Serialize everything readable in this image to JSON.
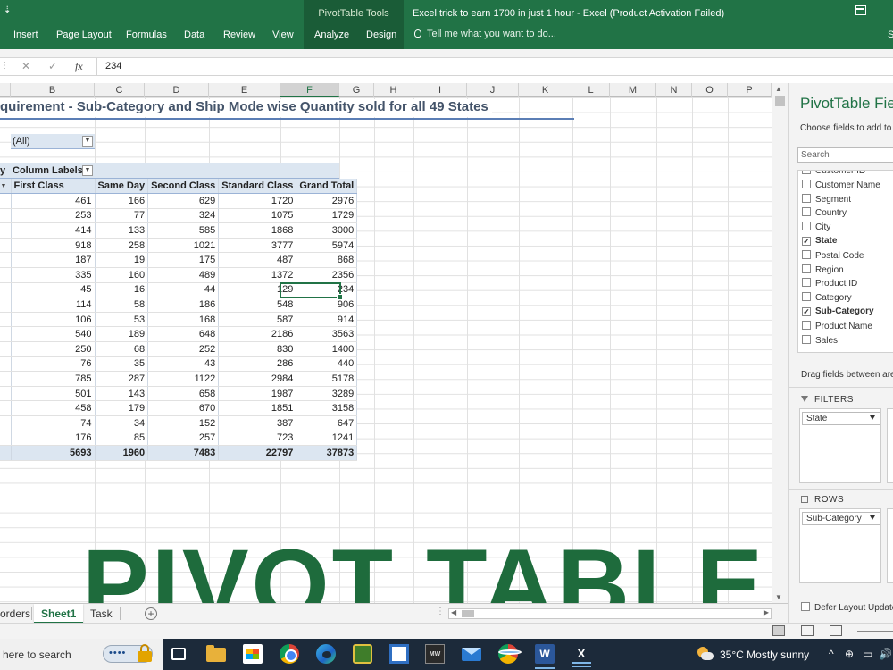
{
  "ribbon": {
    "contextual_group": "PivotTable Tools",
    "window_title": "Excel trick to earn 1700 in just 1 hour - Excel (Product Activation Failed)",
    "tabs": [
      "Insert",
      "Page Layout",
      "Formulas",
      "Data",
      "Review",
      "View",
      "Analyze",
      "Design"
    ],
    "tell_me": "Tell me what you want to do...",
    "user_initial": "S",
    "qa_arrow": "⇣",
    "restore_icon": "ribbon-display-icon"
  },
  "formula_bar": {
    "cancel_glyph": "✕",
    "enter_glyph": "✓",
    "fx": "fx",
    "value": "234"
  },
  "columns": [
    "B",
    "C",
    "D",
    "E",
    "F",
    "G",
    "H",
    "I",
    "J",
    "K",
    "L",
    "M",
    "N",
    "O",
    "P"
  ],
  "selected_column": "F",
  "sheet": {
    "title": "quirement - Sub-Category and Ship Mode wise Quantity sold for all 49 States",
    "filter_value": "(All)",
    "row_labels_fragment": "y",
    "column_labels": "Column Labels",
    "headers": [
      "First Class",
      "Same Day",
      "Second Class",
      "Standard Class",
      "Grand Total"
    ],
    "rows": [
      [
        461,
        166,
        629,
        1720,
        2976
      ],
      [
        253,
        77,
        324,
        1075,
        1729
      ],
      [
        414,
        133,
        585,
        1868,
        3000
      ],
      [
        918,
        258,
        1021,
        3777,
        5974
      ],
      [
        187,
        19,
        175,
        487,
        868
      ],
      [
        335,
        160,
        489,
        1372,
        2356
      ],
      [
        45,
        16,
        44,
        129,
        234
      ],
      [
        114,
        58,
        186,
        548,
        906
      ],
      [
        106,
        53,
        168,
        587,
        914
      ],
      [
        540,
        189,
        648,
        2186,
        3563
      ],
      [
        250,
        68,
        252,
        830,
        1400
      ],
      [
        76,
        35,
        43,
        286,
        440
      ],
      [
        785,
        287,
        1122,
        2984,
        5178
      ],
      [
        501,
        143,
        658,
        1987,
        3289
      ],
      [
        458,
        179,
        670,
        1851,
        3158
      ],
      [
        74,
        34,
        152,
        387,
        647
      ],
      [
        176,
        85,
        257,
        723,
        1241
      ]
    ],
    "totals": [
      "5693",
      "1960",
      "7483",
      "22797",
      "37873"
    ]
  },
  "overlay_text": "PIVOT TABLE",
  "sheet_tabs": [
    {
      "label": "orders",
      "active": false
    },
    {
      "label": "Sheet1",
      "active": true
    },
    {
      "label": "Task",
      "active": false
    }
  ],
  "pivot_pane": {
    "title": "PivotTable Fie",
    "subtitle": "Choose fields to add to r",
    "search_placeholder": "Search",
    "fields": [
      {
        "label": "Customer ID",
        "checked": false
      },
      {
        "label": "Customer Name",
        "checked": false
      },
      {
        "label": "Segment",
        "checked": false
      },
      {
        "label": "Country",
        "checked": false
      },
      {
        "label": "City",
        "checked": false
      },
      {
        "label": "State",
        "checked": true
      },
      {
        "label": "Postal Code",
        "checked": false
      },
      {
        "label": "Region",
        "checked": false
      },
      {
        "label": "Product ID",
        "checked": false
      },
      {
        "label": "Category",
        "checked": false
      },
      {
        "label": "Sub-Category",
        "checked": true
      },
      {
        "label": "Product Name",
        "checked": false
      },
      {
        "label": "Sales",
        "checked": false
      }
    ],
    "drag_text": "Drag fields between are",
    "filters_label": "FILTERS",
    "filters_field": "State",
    "rows_label": "ROWS",
    "rows_field": "Sub-Category",
    "defer_label": "Defer Layout Update"
  },
  "taskbar": {
    "search_text": "here to search",
    "search_badge": "••••",
    "mw_label": "MW",
    "word_label": "W",
    "excel_label": "X",
    "weather": "35°C  Mostly sunny",
    "system_icons": [
      "^",
      "⊕",
      "▭",
      "🔊"
    ]
  },
  "colors": {
    "excel_green": "#217346",
    "pivot_header": "#dce6f1",
    "title_text": "#44546a",
    "overlay": "#1e6b3c"
  }
}
